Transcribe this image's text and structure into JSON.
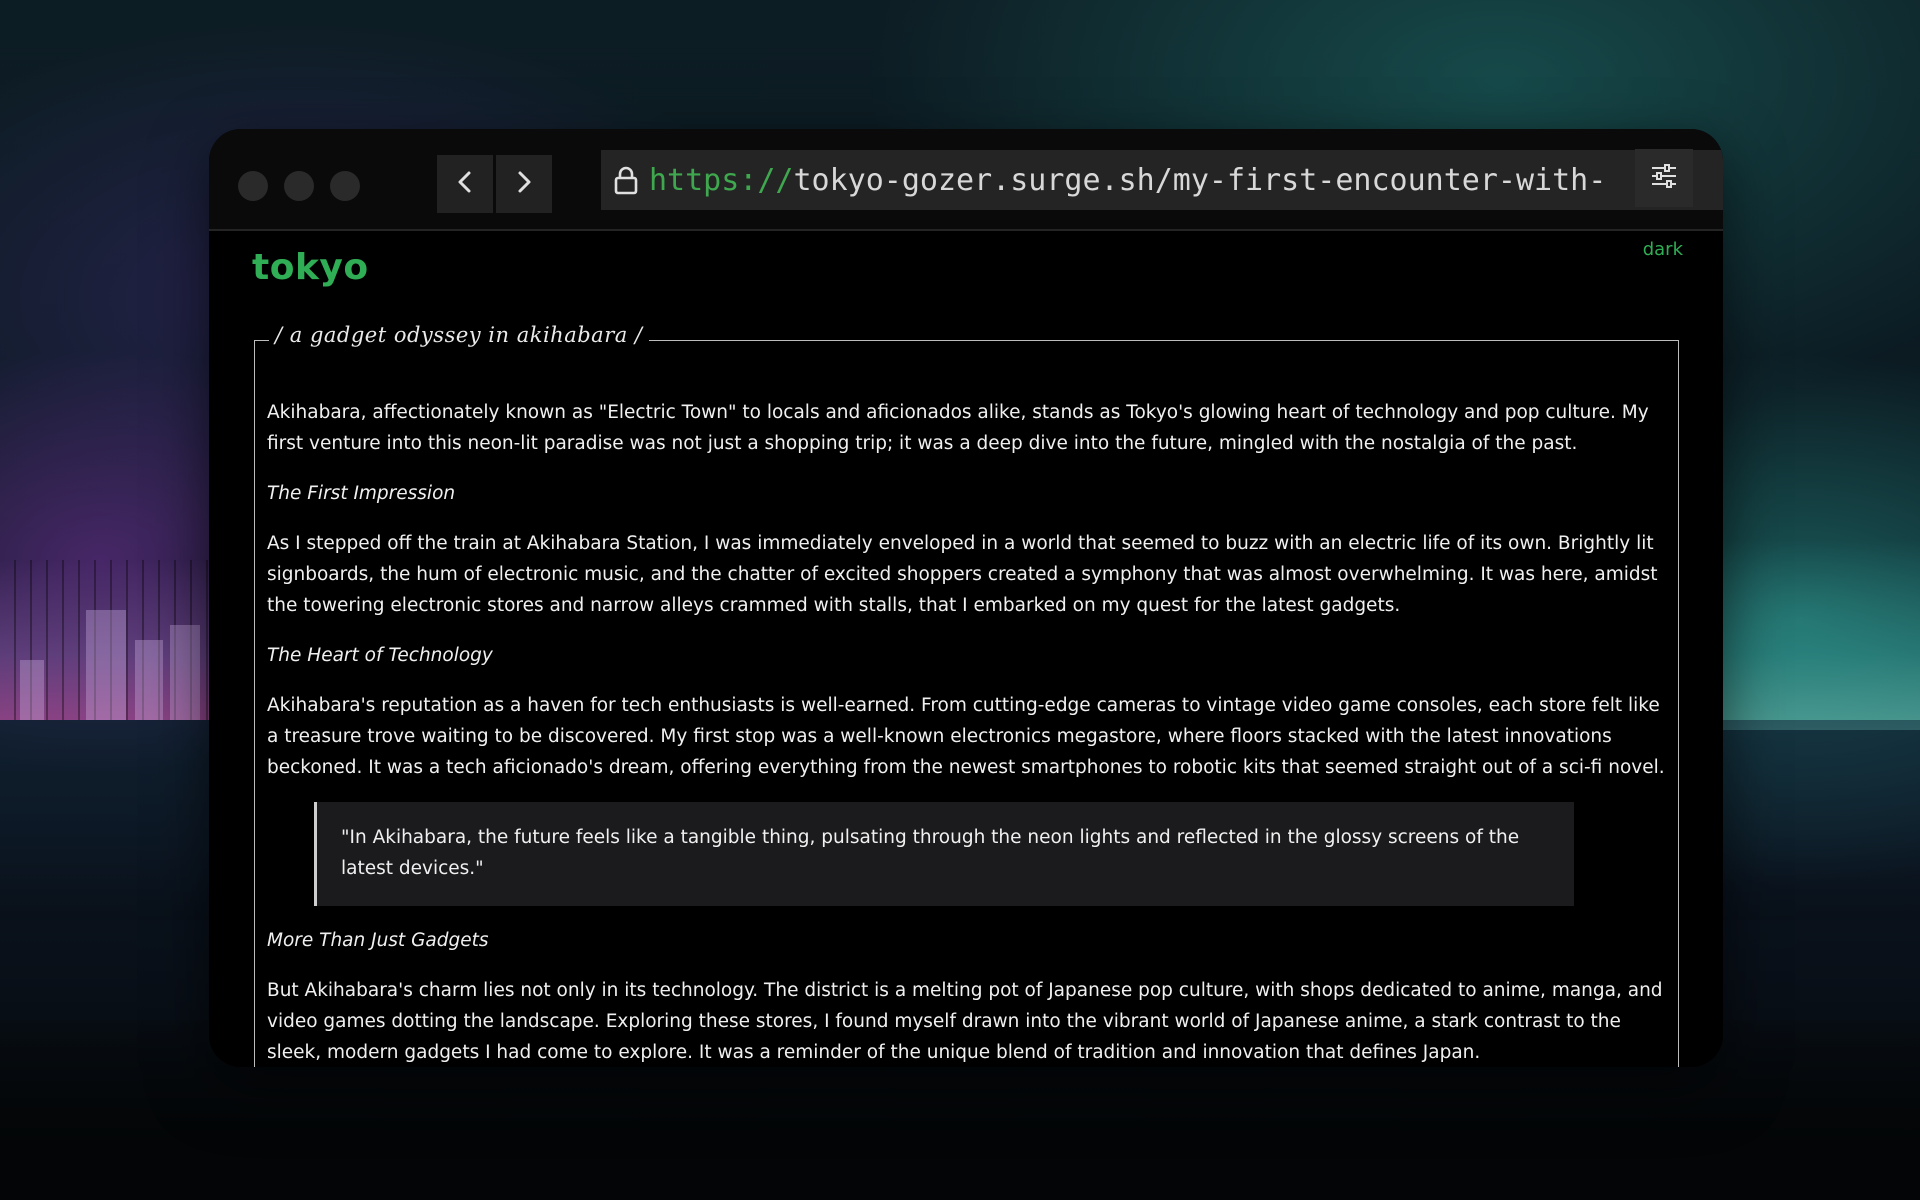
{
  "browser": {
    "url_protocol": "https://",
    "url_rest": "tokyo-gozer.surge.sh/my-first-encounter-with-"
  },
  "site": {
    "title": "tokyo",
    "theme_toggle": "dark"
  },
  "article": {
    "title": "/ a gadget odyssey in akihabara /",
    "intro": "Akihabara, affectionately known as \"Electric Town\" to locals and aficionados alike, stands as Tokyo's glowing heart of technology and pop culture. My first venture into this neon-lit paradise was not just a shopping trip; it was a deep dive into the future, mingled with the nostalgia of the past.",
    "section1_heading": "The First Impression",
    "section1_body": "As I stepped off the train at Akihabara Station, I was immediately enveloped in a world that seemed to buzz with an electric life of its own. Brightly lit signboards, the hum of electronic music, and the chatter of excited shoppers created a symphony that was almost overwhelming. It was here, amidst the towering electronic stores and narrow alleys crammed with stalls, that I embarked on my quest for the latest gadgets.",
    "section2_heading": "The Heart of Technology",
    "section2_body": "Akihabara's reputation as a haven for tech enthusiasts is well-earned. From cutting-edge cameras to vintage video game consoles, each store felt like a treasure trove waiting to be discovered. My first stop was a well-known electronics megastore, where floors stacked with the latest innovations beckoned. It was a tech aficionado's dream, offering everything from the newest smartphones to robotic kits that seemed straight out of a sci-fi novel.",
    "quote": "\"In Akihabara, the future feels like a tangible thing, pulsating through the neon lights and reflected in the glossy screens of the latest devices.\"",
    "section3_heading": "More Than Just Gadgets",
    "section3_body": "But Akihabara's charm lies not only in its technology. The district is a melting pot of Japanese pop culture, with shops dedicated to anime, manga, and video games dotting the landscape. Exploring these stores, I found myself drawn into the vibrant world of Japanese anime, a stark contrast to the sleek, modern gadgets I had come to explore. It was a reminder of the unique blend of tradition and innovation that defines Japan."
  },
  "icons": {
    "lock": "lock-icon",
    "back": "chevron-left-icon",
    "forward": "chevron-right-icon",
    "menu": "sliders-icon"
  }
}
